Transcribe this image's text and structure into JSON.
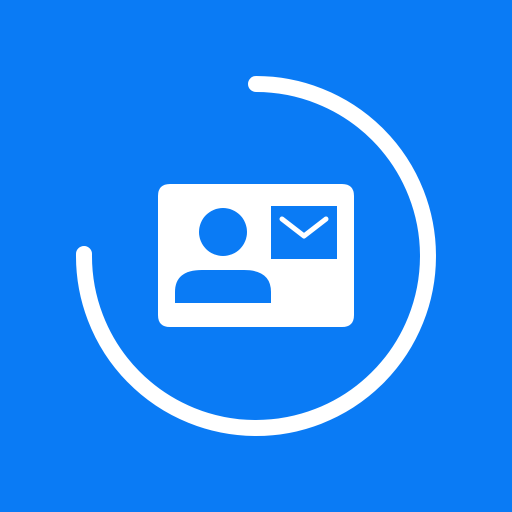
{
  "icon": {
    "name": "contact-card-sync-icon",
    "background_color": "#0a7bf5",
    "foreground_color": "#ffffff",
    "progress_ring": {
      "shape": "open-circle-arc",
      "gap_position": "top-left"
    },
    "card": {
      "elements": [
        "person-icon",
        "envelope-icon"
      ]
    }
  }
}
